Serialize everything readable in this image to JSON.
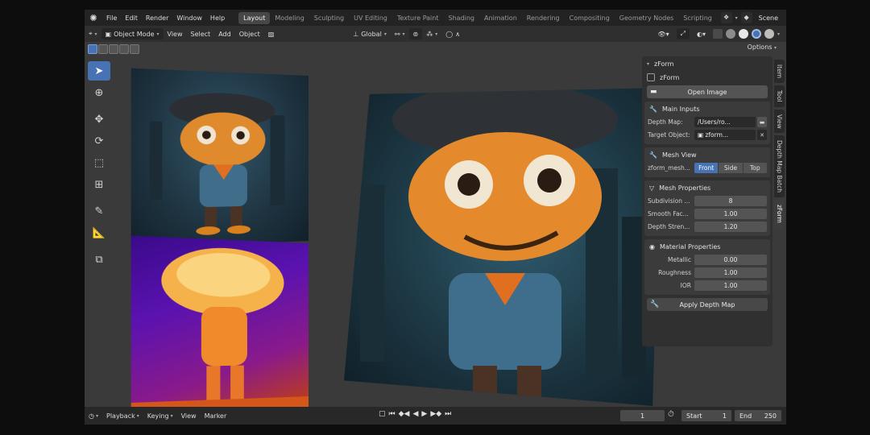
{
  "menu": [
    "File",
    "Edit",
    "Render",
    "Window",
    "Help"
  ],
  "workspace_tabs": [
    "Layout",
    "Modeling",
    "Sculpting",
    "UV Editing",
    "Texture Paint",
    "Shading",
    "Animation",
    "Rendering",
    "Compositing",
    "Geometry Nodes",
    "Scripting"
  ],
  "active_tab": "Layout",
  "scene": "Scene",
  "header": {
    "mode": "Object Mode",
    "view": "View",
    "select": "Select",
    "add": "Add",
    "object": "Object",
    "orientation": "Global"
  },
  "options": "Options",
  "panel": {
    "title": "zForm",
    "enable_label": "zForm",
    "open_image": "Open Image",
    "main_inputs": {
      "title": "Main Inputs",
      "depth_map_label": "Depth Map:",
      "depth_map_value": "/Users/ro...",
      "target_label": "Target Object:",
      "target_value": "zform..."
    },
    "mesh_view": {
      "title": "Mesh View",
      "object": "zform_mesh...",
      "front": "Front",
      "side": "Side",
      "top": "Top"
    },
    "mesh_props": {
      "title": "Mesh Properties",
      "subdiv_label": "Subdivision ...",
      "subdiv_value": "8",
      "smooth_label": "Smooth Fac...",
      "smooth_value": "1.00",
      "depth_label": "Depth Stren...",
      "depth_value": "1.20"
    },
    "material": {
      "title": "Material Properties",
      "metallic_label": "Metallic",
      "metallic_value": "0.00",
      "roughness_label": "Roughness",
      "roughness_value": "1.00",
      "ior_label": "IOR",
      "ior_value": "1.00"
    },
    "apply": "Apply Depth Map"
  },
  "side_tabs": [
    "Item",
    "Tool",
    "View",
    "Depth Map Batch",
    "zForm"
  ],
  "timeline": {
    "playback": "Playback",
    "keying": "Keying",
    "view": "View",
    "marker": "Marker",
    "current_frame": "1",
    "start_label": "Start",
    "start_value": "1",
    "end_label": "End",
    "end_value": "250"
  }
}
